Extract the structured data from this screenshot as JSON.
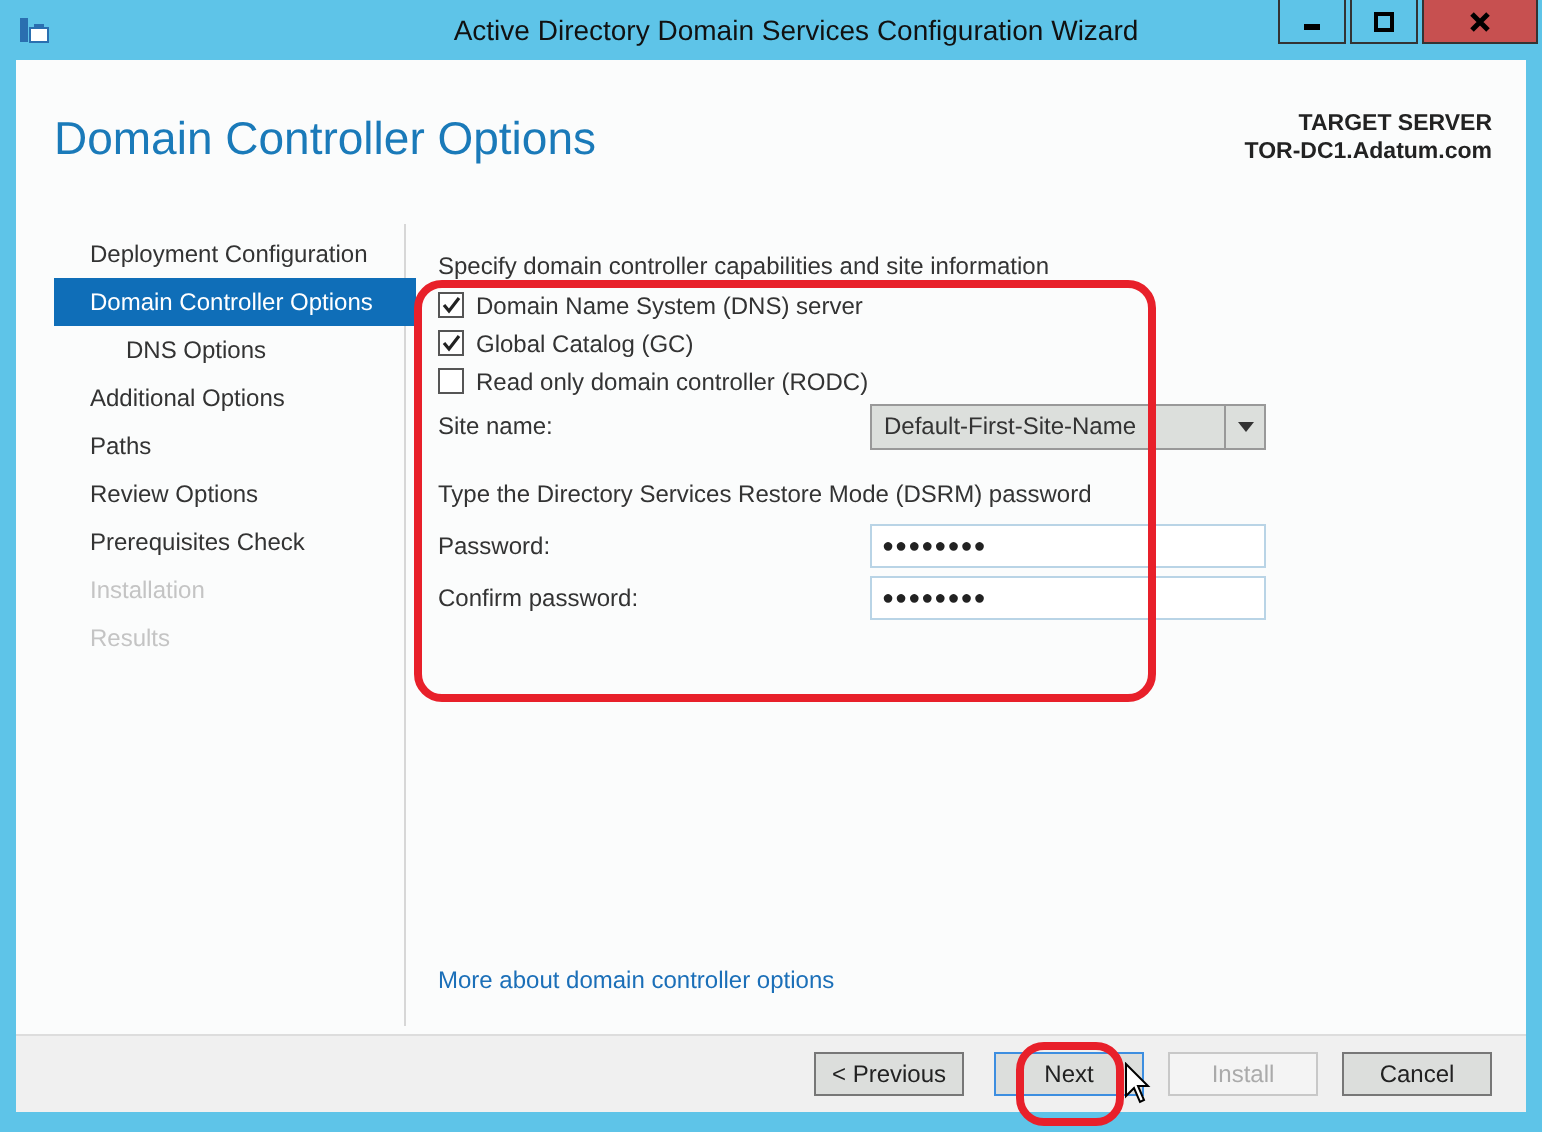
{
  "window": {
    "title": "Active Directory Domain Services Configuration Wizard"
  },
  "header": {
    "page_title": "Domain Controller Options",
    "target_label": "TARGET SERVER",
    "target_server": "TOR-DC1.Adatum.com"
  },
  "sidebar": {
    "items": [
      {
        "label": "Deployment Configuration",
        "selected": false,
        "disabled": false
      },
      {
        "label": "Domain Controller Options",
        "selected": true,
        "disabled": false,
        "children": [
          {
            "label": "DNS Options",
            "selected": false,
            "disabled": false
          }
        ]
      },
      {
        "label": "Additional Options",
        "selected": false,
        "disabled": false
      },
      {
        "label": "Paths",
        "selected": false,
        "disabled": false
      },
      {
        "label": "Review Options",
        "selected": false,
        "disabled": false
      },
      {
        "label": "Prerequisites Check",
        "selected": false,
        "disabled": false
      },
      {
        "label": "Installation",
        "selected": false,
        "disabled": true
      },
      {
        "label": "Results",
        "selected": false,
        "disabled": true
      }
    ]
  },
  "content": {
    "intro": "Specify domain controller capabilities and site information",
    "options": [
      {
        "label": "Domain Name System (DNS) server",
        "checked": true
      },
      {
        "label": "Global Catalog (GC)",
        "checked": true
      },
      {
        "label": "Read only domain controller (RODC)",
        "checked": false
      }
    ],
    "site": {
      "label": "Site name:",
      "value": "Default-First-Site-Name"
    },
    "dsrm_intro": "Type the Directory Services Restore Mode (DSRM) password",
    "passwords": [
      {
        "label": "Password:",
        "value": "●●●●●●●●"
      },
      {
        "label": "Confirm password:",
        "value": "●●●●●●●●"
      }
    ],
    "more_link": "More about domain controller options"
  },
  "buttons": [
    {
      "label": "< Previous",
      "disabled": false,
      "focused": false
    },
    {
      "label": "Next",
      "disabled": false,
      "focused": true
    },
    {
      "label": "Install",
      "disabled": true,
      "focused": false
    },
    {
      "label": "Cancel",
      "disabled": false,
      "focused": false
    }
  ]
}
